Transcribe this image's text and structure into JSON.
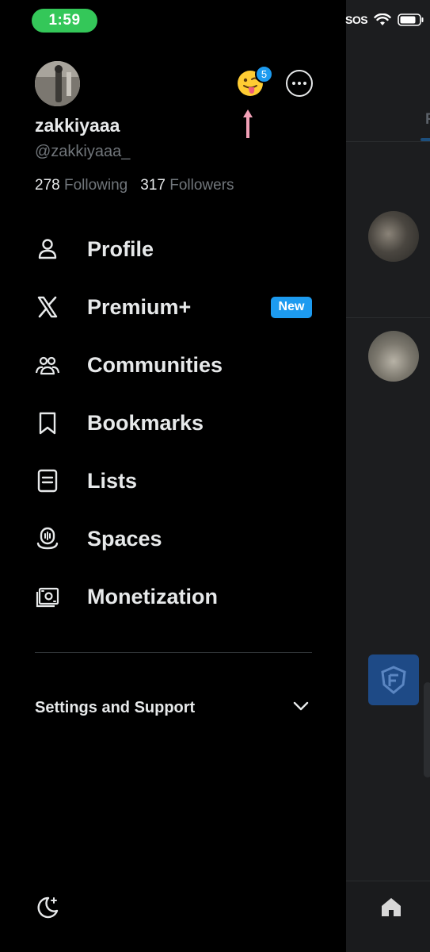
{
  "status_bar": {
    "time": "1:59",
    "sos": "SOS"
  },
  "profile": {
    "display_name": "zakkiyaaa",
    "handle": "@zakkiyaaa_",
    "following_count": "278",
    "following_label": "Following",
    "followers_count": "317",
    "followers_label": "Followers",
    "notification_badge": "5"
  },
  "nav": {
    "items": [
      {
        "label": "Profile",
        "icon": "person-icon"
      },
      {
        "label": "Premium+",
        "icon": "x-logo-icon",
        "badge": "New"
      },
      {
        "label": "Communities",
        "icon": "communities-icon"
      },
      {
        "label": "Bookmarks",
        "icon": "bookmark-icon"
      },
      {
        "label": "Lists",
        "icon": "list-icon"
      },
      {
        "label": "Spaces",
        "icon": "spaces-icon"
      },
      {
        "label": "Monetization",
        "icon": "money-icon"
      }
    ]
  },
  "settings": {
    "label": "Settings and Support",
    "icon": "chevron-down-icon"
  },
  "footer": {
    "icon": "moon-icon"
  },
  "background": {
    "tab_letter": "F"
  },
  "colors": {
    "accent": "#1d9bf0",
    "status_green": "#34c759",
    "arrow_pink": "#f2a0b6"
  }
}
